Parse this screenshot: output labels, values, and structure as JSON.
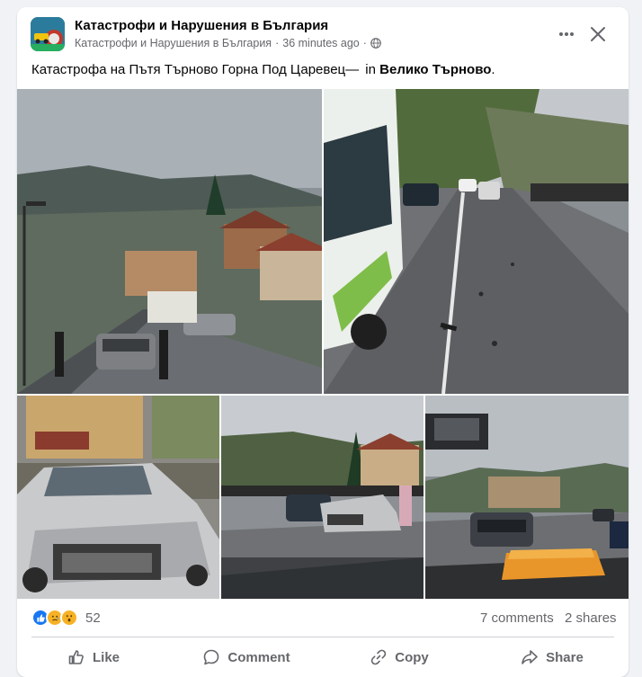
{
  "post": {
    "group_name": "Катастрофи и Нарушения в България",
    "author": "Катастрофи и Нарушения в България",
    "separator": "·",
    "time": "36 minutes ago",
    "privacy_icon": "globe-icon",
    "text_main": "Катастрофа на Пътя Търново Горна Под Царевец—",
    "text_in": "in",
    "location": "Велико Търново",
    "text_end": "."
  },
  "photos": [
    {
      "name": "photo-street-overview"
    },
    {
      "name": "photo-road-debris"
    },
    {
      "name": "photo-damaged-mercedes"
    },
    {
      "name": "photo-crash-scene"
    },
    {
      "name": "photo-through-windshield"
    }
  ],
  "stats": {
    "reaction_icons": [
      "like-icon",
      "sad-icon",
      "wow-icon"
    ],
    "reaction_count": "52",
    "comments": "7 comments",
    "shares": "2 shares"
  },
  "actions": {
    "like": "Like",
    "comment": "Comment",
    "copy": "Copy",
    "share": "Share"
  },
  "colors": {
    "accent": "#1877f2",
    "secondary_text": "#65676b",
    "background": "#f0f2f5"
  }
}
